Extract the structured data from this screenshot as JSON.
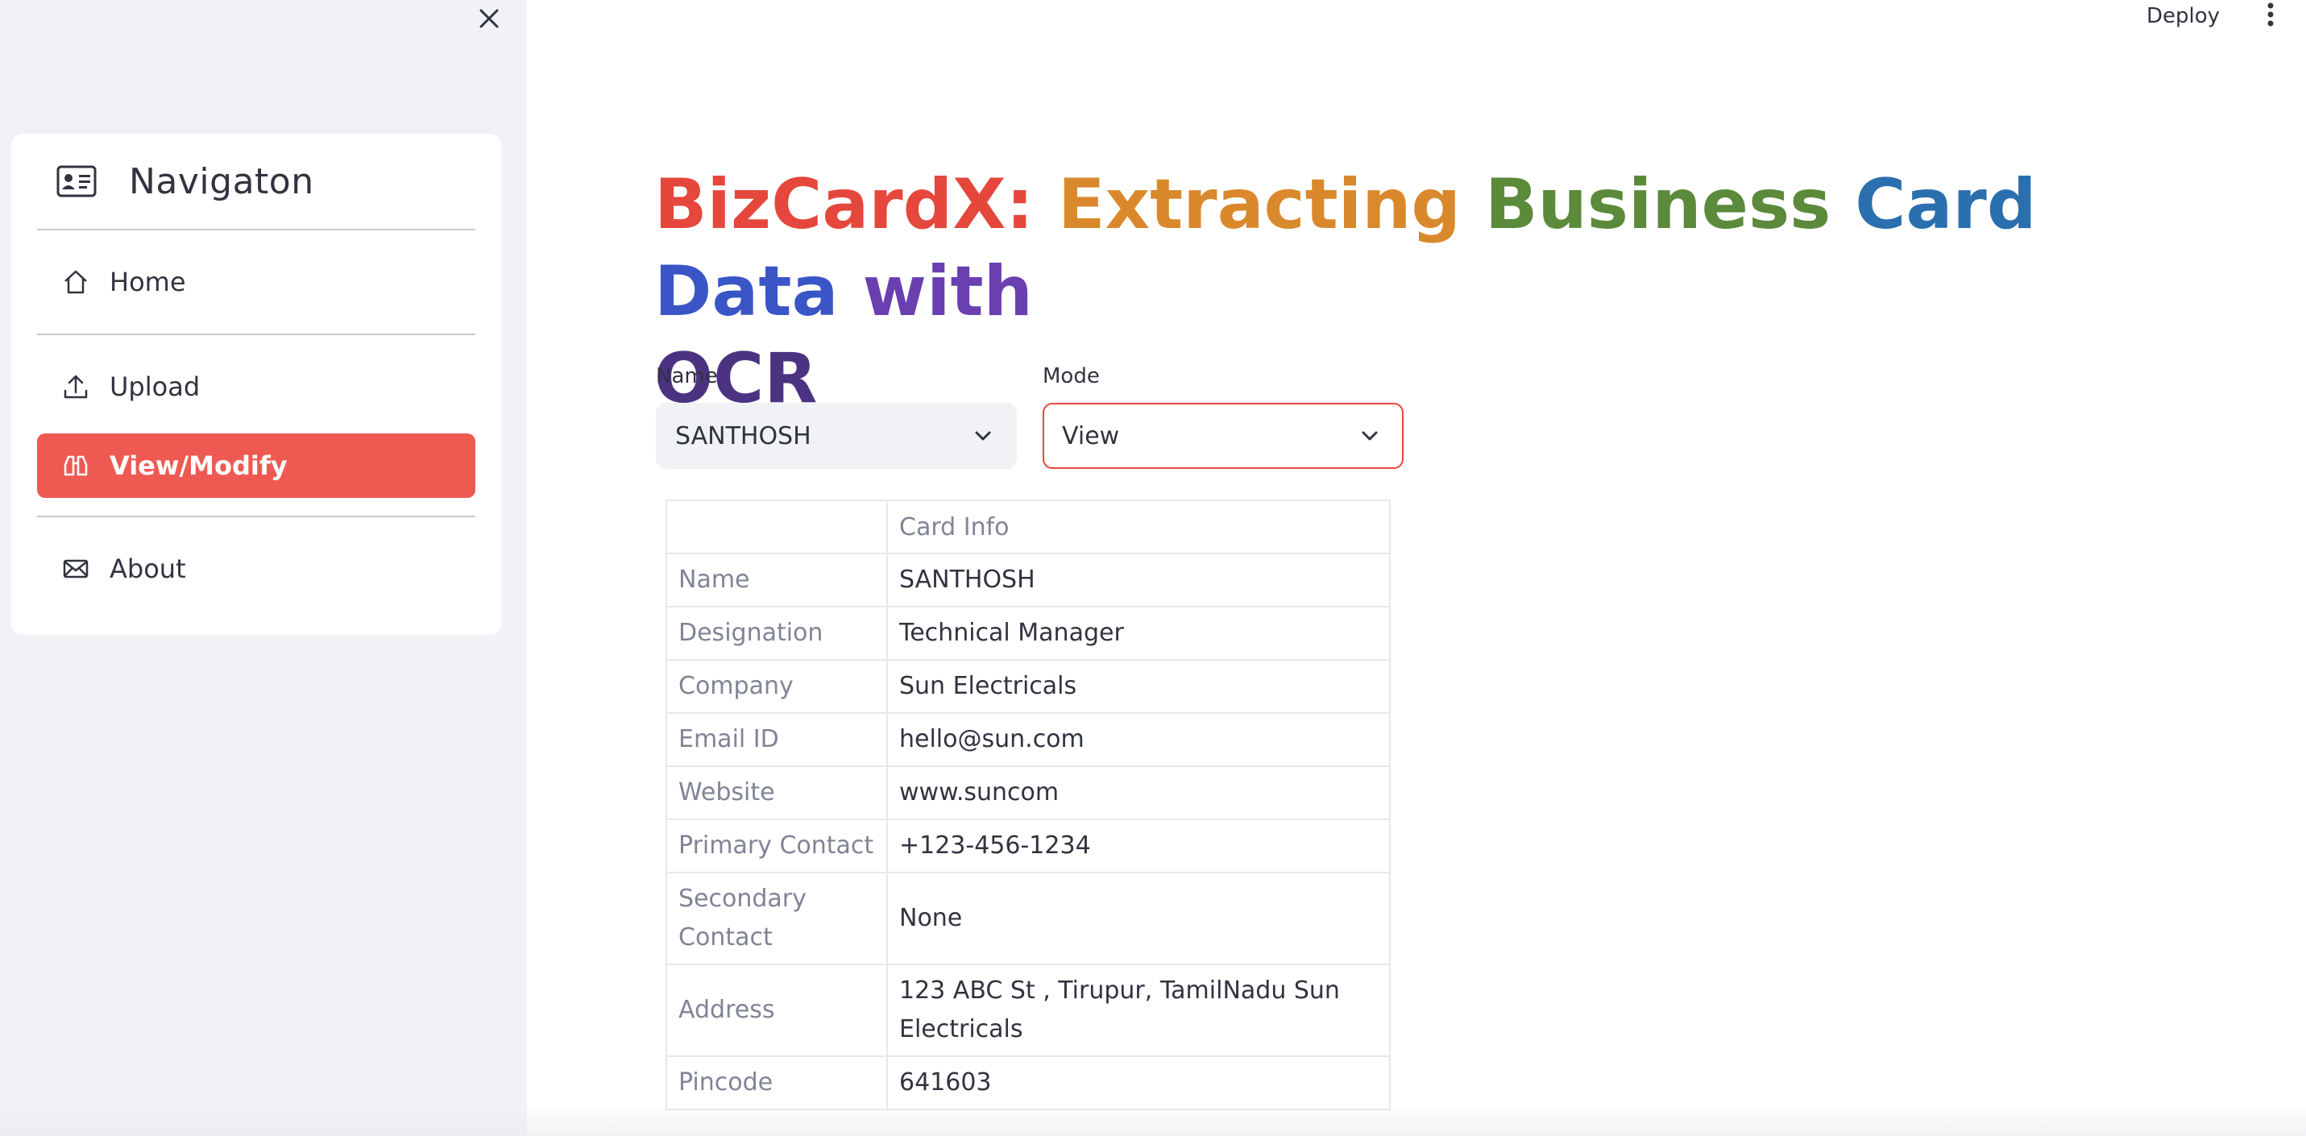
{
  "sidebar": {
    "nav_title": "Navigaton",
    "items": [
      {
        "label": "Home",
        "icon": "home-icon",
        "active": false
      },
      {
        "label": "Upload",
        "icon": "upload-icon",
        "active": false
      },
      {
        "label": "View/Modify",
        "icon": "binoculars-icon",
        "active": true
      },
      {
        "label": "About",
        "icon": "envelope-icon",
        "active": false
      }
    ],
    "active_color": "#ee5a52"
  },
  "topbar": {
    "deploy_label": "Deploy"
  },
  "main": {
    "title_parts": [
      {
        "text": "BizCardX:",
        "color": "#e5473c"
      },
      {
        "text": "Extracting",
        "color": "#d9892c"
      },
      {
        "text": "Business",
        "color": "#5a8a3a"
      },
      {
        "text": "Card",
        "color": "#2a6fae"
      },
      {
        "text": "Data",
        "color": "#3a55c6"
      },
      {
        "text": "with",
        "color": "#6a3fb0"
      },
      {
        "text": "OCR",
        "color": "#4b3382"
      }
    ],
    "name_select": {
      "label": "Name",
      "value": "SANTHOSH"
    },
    "mode_select": {
      "label": "Mode",
      "value": "View"
    },
    "table": {
      "header": "Card Info",
      "rows": [
        {
          "key": "Name",
          "value": "SANTHOSH"
        },
        {
          "key": "Designation",
          "value": "Technical Manager"
        },
        {
          "key": "Company",
          "value": "Sun Electricals"
        },
        {
          "key": "Email ID",
          "value": "hello@sun.com"
        },
        {
          "key": "Website",
          "value": "www.suncom"
        },
        {
          "key": "Primary Contact",
          "value": "+123-456-1234"
        },
        {
          "key": "Secondary Contact",
          "value": "None"
        },
        {
          "key": "Address",
          "value": "123 ABC St , Tirupur, TamilNadu Sun Electricals"
        },
        {
          "key": "Pincode",
          "value": "641603"
        }
      ]
    }
  }
}
